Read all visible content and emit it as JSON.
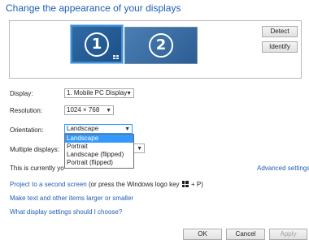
{
  "title": "Change the appearance of your displays",
  "monitors": [
    {
      "number": "1",
      "selected": true
    },
    {
      "number": "2",
      "selected": false
    }
  ],
  "buttons": {
    "detect": "Detect",
    "identify": "Identify",
    "ok": "OK",
    "cancel": "Cancel",
    "apply": "Apply"
  },
  "fields": {
    "display": {
      "label": "Display:",
      "value": "1. Mobile PC Display"
    },
    "resolution": {
      "label": "Resolution:",
      "value": "1024 × 768"
    },
    "orientation": {
      "label": "Orientation:",
      "value": "Landscape",
      "options": [
        "Landscape",
        "Portrait",
        "Landscape (flipped)",
        "Portrait (flipped)"
      ],
      "highlighted": "Landscape"
    },
    "multiple_displays": {
      "label": "Multiple displays:"
    }
  },
  "status_text": "This is currently yo",
  "links": {
    "advanced": "Advanced settings",
    "project_prefix": "Project to a second screen",
    "project_suffix_a": " (or press the Windows logo key ",
    "project_suffix_b": " + P)",
    "text_size": "Make text and other items larger or smaller",
    "which_settings": "What display settings should I choose?"
  },
  "colors": {
    "link": "#1e5fb4",
    "highlight": "#3399ff",
    "monitor_selected_border": "#3d8fd6"
  },
  "icons": {
    "chevron": "chevron-down-icon",
    "windows_logo": "windows-logo-icon",
    "taskbar": "taskbar-icon"
  }
}
